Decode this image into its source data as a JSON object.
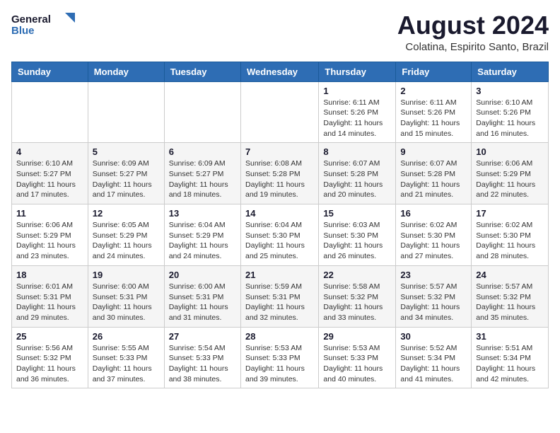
{
  "header": {
    "logo_line1": "General",
    "logo_line2": "Blue",
    "month_title": "August 2024",
    "location": "Colatina, Espirito Santo, Brazil"
  },
  "weekdays": [
    "Sunday",
    "Monday",
    "Tuesday",
    "Wednesday",
    "Thursday",
    "Friday",
    "Saturday"
  ],
  "weeks": [
    [
      {
        "day": "",
        "info": ""
      },
      {
        "day": "",
        "info": ""
      },
      {
        "day": "",
        "info": ""
      },
      {
        "day": "",
        "info": ""
      },
      {
        "day": "1",
        "info": "Sunrise: 6:11 AM\nSunset: 5:26 PM\nDaylight: 11 hours\nand 14 minutes."
      },
      {
        "day": "2",
        "info": "Sunrise: 6:11 AM\nSunset: 5:26 PM\nDaylight: 11 hours\nand 15 minutes."
      },
      {
        "day": "3",
        "info": "Sunrise: 6:10 AM\nSunset: 5:26 PM\nDaylight: 11 hours\nand 16 minutes."
      }
    ],
    [
      {
        "day": "4",
        "info": "Sunrise: 6:10 AM\nSunset: 5:27 PM\nDaylight: 11 hours\nand 17 minutes."
      },
      {
        "day": "5",
        "info": "Sunrise: 6:09 AM\nSunset: 5:27 PM\nDaylight: 11 hours\nand 17 minutes."
      },
      {
        "day": "6",
        "info": "Sunrise: 6:09 AM\nSunset: 5:27 PM\nDaylight: 11 hours\nand 18 minutes."
      },
      {
        "day": "7",
        "info": "Sunrise: 6:08 AM\nSunset: 5:28 PM\nDaylight: 11 hours\nand 19 minutes."
      },
      {
        "day": "8",
        "info": "Sunrise: 6:07 AM\nSunset: 5:28 PM\nDaylight: 11 hours\nand 20 minutes."
      },
      {
        "day": "9",
        "info": "Sunrise: 6:07 AM\nSunset: 5:28 PM\nDaylight: 11 hours\nand 21 minutes."
      },
      {
        "day": "10",
        "info": "Sunrise: 6:06 AM\nSunset: 5:29 PM\nDaylight: 11 hours\nand 22 minutes."
      }
    ],
    [
      {
        "day": "11",
        "info": "Sunrise: 6:06 AM\nSunset: 5:29 PM\nDaylight: 11 hours\nand 23 minutes."
      },
      {
        "day": "12",
        "info": "Sunrise: 6:05 AM\nSunset: 5:29 PM\nDaylight: 11 hours\nand 24 minutes."
      },
      {
        "day": "13",
        "info": "Sunrise: 6:04 AM\nSunset: 5:29 PM\nDaylight: 11 hours\nand 24 minutes."
      },
      {
        "day": "14",
        "info": "Sunrise: 6:04 AM\nSunset: 5:30 PM\nDaylight: 11 hours\nand 25 minutes."
      },
      {
        "day": "15",
        "info": "Sunrise: 6:03 AM\nSunset: 5:30 PM\nDaylight: 11 hours\nand 26 minutes."
      },
      {
        "day": "16",
        "info": "Sunrise: 6:02 AM\nSunset: 5:30 PM\nDaylight: 11 hours\nand 27 minutes."
      },
      {
        "day": "17",
        "info": "Sunrise: 6:02 AM\nSunset: 5:30 PM\nDaylight: 11 hours\nand 28 minutes."
      }
    ],
    [
      {
        "day": "18",
        "info": "Sunrise: 6:01 AM\nSunset: 5:31 PM\nDaylight: 11 hours\nand 29 minutes."
      },
      {
        "day": "19",
        "info": "Sunrise: 6:00 AM\nSunset: 5:31 PM\nDaylight: 11 hours\nand 30 minutes."
      },
      {
        "day": "20",
        "info": "Sunrise: 6:00 AM\nSunset: 5:31 PM\nDaylight: 11 hours\nand 31 minutes."
      },
      {
        "day": "21",
        "info": "Sunrise: 5:59 AM\nSunset: 5:31 PM\nDaylight: 11 hours\nand 32 minutes."
      },
      {
        "day": "22",
        "info": "Sunrise: 5:58 AM\nSunset: 5:32 PM\nDaylight: 11 hours\nand 33 minutes."
      },
      {
        "day": "23",
        "info": "Sunrise: 5:57 AM\nSunset: 5:32 PM\nDaylight: 11 hours\nand 34 minutes."
      },
      {
        "day": "24",
        "info": "Sunrise: 5:57 AM\nSunset: 5:32 PM\nDaylight: 11 hours\nand 35 minutes."
      }
    ],
    [
      {
        "day": "25",
        "info": "Sunrise: 5:56 AM\nSunset: 5:32 PM\nDaylight: 11 hours\nand 36 minutes."
      },
      {
        "day": "26",
        "info": "Sunrise: 5:55 AM\nSunset: 5:33 PM\nDaylight: 11 hours\nand 37 minutes."
      },
      {
        "day": "27",
        "info": "Sunrise: 5:54 AM\nSunset: 5:33 PM\nDaylight: 11 hours\nand 38 minutes."
      },
      {
        "day": "28",
        "info": "Sunrise: 5:53 AM\nSunset: 5:33 PM\nDaylight: 11 hours\nand 39 minutes."
      },
      {
        "day": "29",
        "info": "Sunrise: 5:53 AM\nSunset: 5:33 PM\nDaylight: 11 hours\nand 40 minutes."
      },
      {
        "day": "30",
        "info": "Sunrise: 5:52 AM\nSunset: 5:34 PM\nDaylight: 11 hours\nand 41 minutes."
      },
      {
        "day": "31",
        "info": "Sunrise: 5:51 AM\nSunset: 5:34 PM\nDaylight: 11 hours\nand 42 minutes."
      }
    ]
  ]
}
